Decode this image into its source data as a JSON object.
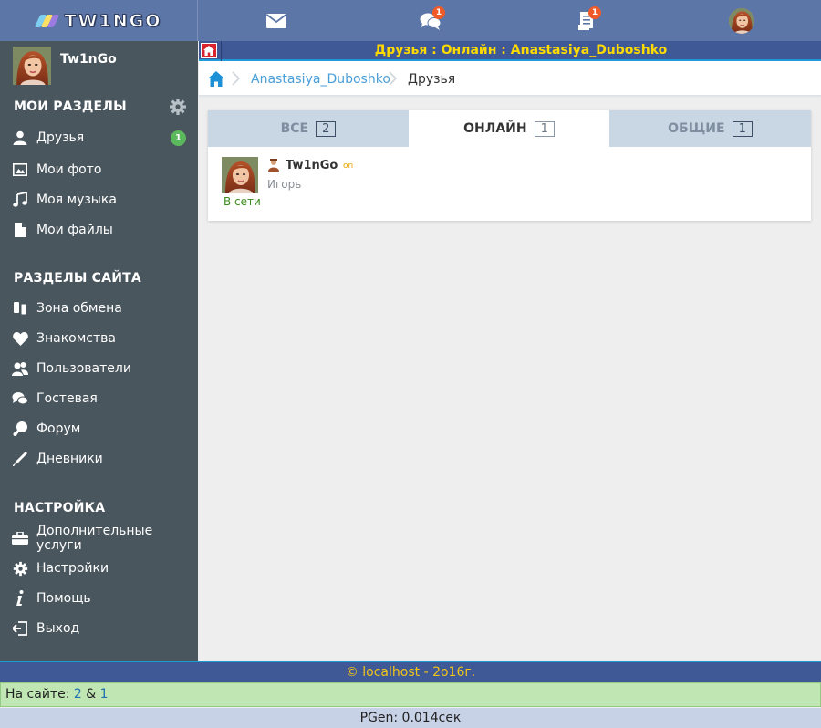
{
  "brand": {
    "logo_text": "TW1NGO"
  },
  "topbar": {
    "messages_icon": "envelope-icon",
    "chat_icon": "chat-bubbles-icon",
    "chat_badge": "1",
    "notes_icon": "document-list-icon",
    "notes_badge": "1",
    "avatar_icon": "user-avatar"
  },
  "sidebar": {
    "user_name": "Tw1nGo",
    "my_sections": {
      "title": "МОИ РАЗДЕЛЫ",
      "items": [
        {
          "label": "Друзья",
          "icon": "user-icon",
          "count": "1"
        },
        {
          "label": "Мои фото",
          "icon": "image-icon"
        },
        {
          "label": "Моя музыка",
          "icon": "music-note-icon"
        },
        {
          "label": "Мои файлы",
          "icon": "file-icon"
        }
      ]
    },
    "site_sections": {
      "title": "РАЗДЕЛЫ САЙТА",
      "items": [
        {
          "label": "Зона обмена",
          "icon": "exchange-icon"
        },
        {
          "label": "Знакомства",
          "icon": "heart-icon"
        },
        {
          "label": "Пользователи",
          "icon": "users-icon"
        },
        {
          "label": "Гостевая",
          "icon": "comments-icon"
        },
        {
          "label": "Форум",
          "icon": "forum-icon"
        },
        {
          "label": "Дневники",
          "icon": "pen-icon"
        }
      ]
    },
    "settings_sections": {
      "title": "НАСТРОЙКА",
      "items": [
        {
          "label": "Дополнительные услуги",
          "icon": "briefcase-icon"
        },
        {
          "label": "Настройки",
          "icon": "gear-icon"
        },
        {
          "label": "Помощь",
          "icon": "info-icon"
        },
        {
          "label": "Выход",
          "icon": "logout-icon"
        }
      ]
    }
  },
  "page": {
    "title": "Друзья : Онлайн : Anastasiya_Duboshko",
    "breadcrumbs": [
      "Anastasiya_Duboshko",
      "Друзья"
    ]
  },
  "tabs": [
    {
      "label": "ВСЕ",
      "count": "2",
      "active": false
    },
    {
      "label": "ОНЛАЙН",
      "count": "1",
      "active": true
    },
    {
      "label": "ОБЩИЕ",
      "count": "1",
      "active": false
    }
  ],
  "friends": [
    {
      "name": "Tw1nGo",
      "badge": "on",
      "subtitle": "Игорь",
      "status": "В сети"
    }
  ],
  "footer": {
    "copyright": "© localhost - 2о16г.",
    "online_label": "На сайте:",
    "online_users": "2",
    "online_sep": "&",
    "online_guests": "1",
    "pgen": "PGen: 0.014сек"
  },
  "colors": {
    "header": "#5d76a8",
    "sidebar": "#4a565e",
    "title_text": "#ffdb00",
    "online_badge": "#5cb85c",
    "notify_badge": "#f05a28"
  }
}
